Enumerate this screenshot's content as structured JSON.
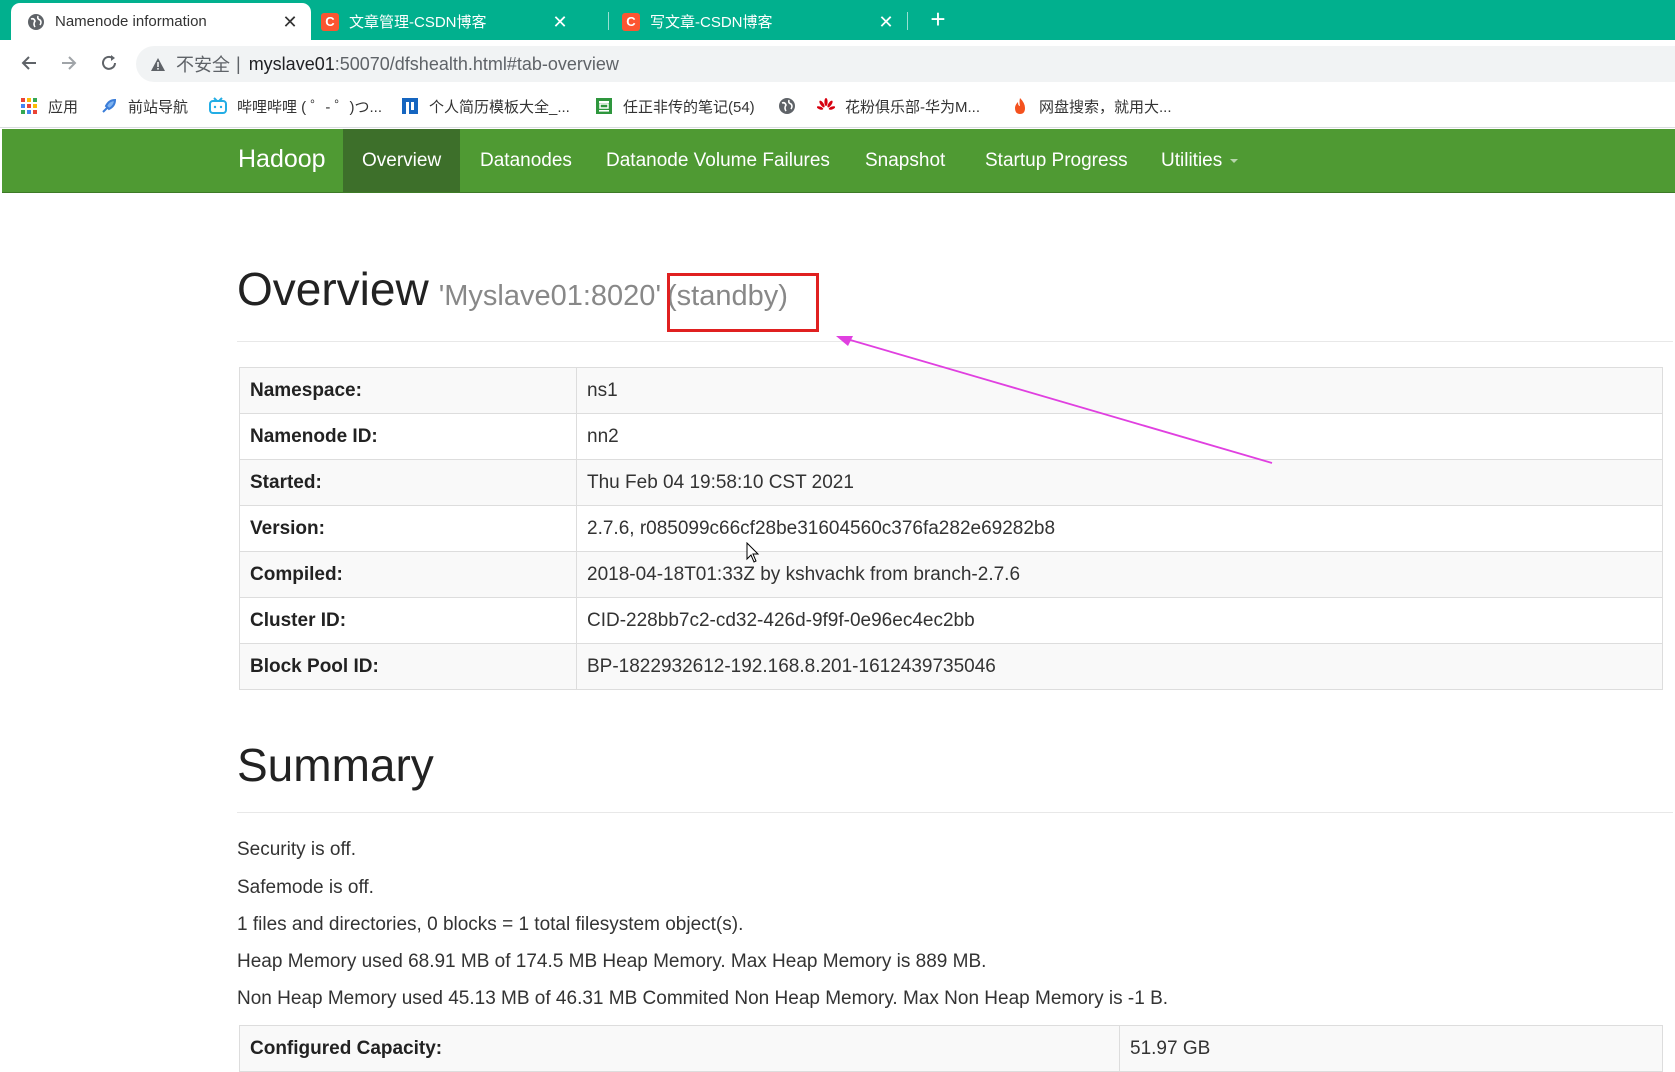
{
  "browser": {
    "tabs": [
      {
        "title": "Namenode information",
        "icon": "globe-icon",
        "active": true
      },
      {
        "title": "文章管理-CSDN博客",
        "icon": "csdn-icon",
        "icon_text": "C",
        "active": false
      },
      {
        "title": "写文章-CSDN博客",
        "icon": "csdn-icon",
        "icon_text": "C",
        "active": false
      }
    ],
    "close_glyph": "✕",
    "new_tab_glyph": "+",
    "address": {
      "insecure_label": "不安全",
      "separator": "|",
      "host": "myslave01",
      "path": ":50070/dfshealth.html#tab-overview"
    },
    "bookmarks": [
      {
        "label": "应用",
        "icon": "apps-grid-icon"
      },
      {
        "label": "前站导航",
        "icon": "rocket-icon"
      },
      {
        "label": "哔哩哔哩 ( ゜- ゜)つ...",
        "icon": "bilibili-icon"
      },
      {
        "label": "个人简历模板大全_...",
        "icon": "resume-icon"
      },
      {
        "label": "任正非传的笔记(54)",
        "icon": "douban-icon"
      },
      {
        "label": "",
        "icon": "globe-icon"
      },
      {
        "label": "花粉俱乐部-华为M...",
        "icon": "huawei-icon"
      },
      {
        "label": "网盘搜索，就用大...",
        "icon": "fire-icon"
      }
    ],
    "accent": "#01b08e"
  },
  "hadoop": {
    "brand": "Hadoop",
    "nav": [
      "Overview",
      "Datanodes",
      "Datanode Volume Failures",
      "Snapshot",
      "Startup Progress",
      "Utilities"
    ],
    "nav_active": "Overview",
    "nav_color": "#4f9a33",
    "overview": {
      "title": "Overview",
      "host": "'Myslave01:8020'",
      "state": "(standby)",
      "rows": [
        {
          "key": "Namespace:",
          "value": "ns1"
        },
        {
          "key": "Namenode ID:",
          "value": "nn2"
        },
        {
          "key": "Started:",
          "value": "Thu Feb 04 19:58:10 CST 2021"
        },
        {
          "key": "Version:",
          "value": "2.7.6, r085099c66cf28be31604560c376fa282e69282b8"
        },
        {
          "key": "Compiled:",
          "value": "2018-04-18T01:33Z by kshvachk from branch-2.7.6"
        },
        {
          "key": "Cluster ID:",
          "value": "CID-228bb7c2-cd32-426d-9f9f-0e96ec4ec2bb"
        },
        {
          "key": "Block Pool ID:",
          "value": "BP-1822932612-192.168.8.201-1612439735046"
        }
      ]
    },
    "summary": {
      "title": "Summary",
      "lines": [
        "Security is off.",
        "Safemode is off.",
        "1 files and directories, 0 blocks = 1 total filesystem object(s).",
        "Heap Memory used 68.91 MB of 174.5 MB Heap Memory. Max Heap Memory is 889 MB.",
        "Non Heap Memory used 45.13 MB of 46.31 MB Commited Non Heap Memory. Max Non Heap Memory is -1 B."
      ],
      "capacity": {
        "key": "Configured Capacity:",
        "value": "51.97 GB"
      }
    }
  },
  "annotation": {
    "box_color": "#e02020",
    "arrow_color": "#e040e0"
  }
}
